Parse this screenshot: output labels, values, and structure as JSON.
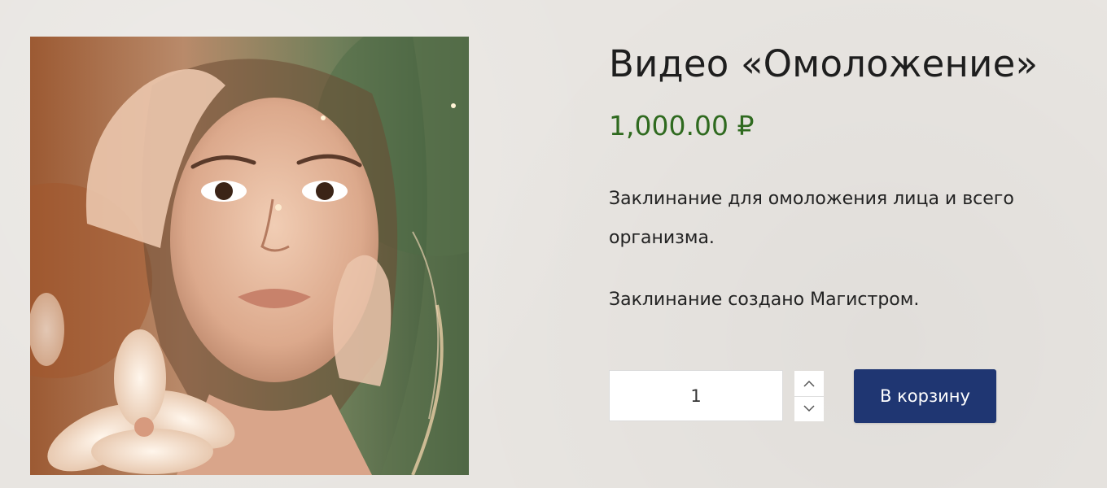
{
  "product": {
    "title": "Видео «Омоложение»",
    "price": "1,000.00 ₽",
    "description": [
      "Заклинание для омоложения лица и всего организма.",
      "Заклинание создано Магистром."
    ],
    "quantity": "1",
    "add_to_cart_label": "В корзину"
  },
  "icons": {
    "increment": "chevron-up-icon",
    "decrement": "chevron-down-icon"
  },
  "colors": {
    "price": "#2f6a1f",
    "cart_button": "#1f3672",
    "background": "#e8e5e1"
  }
}
